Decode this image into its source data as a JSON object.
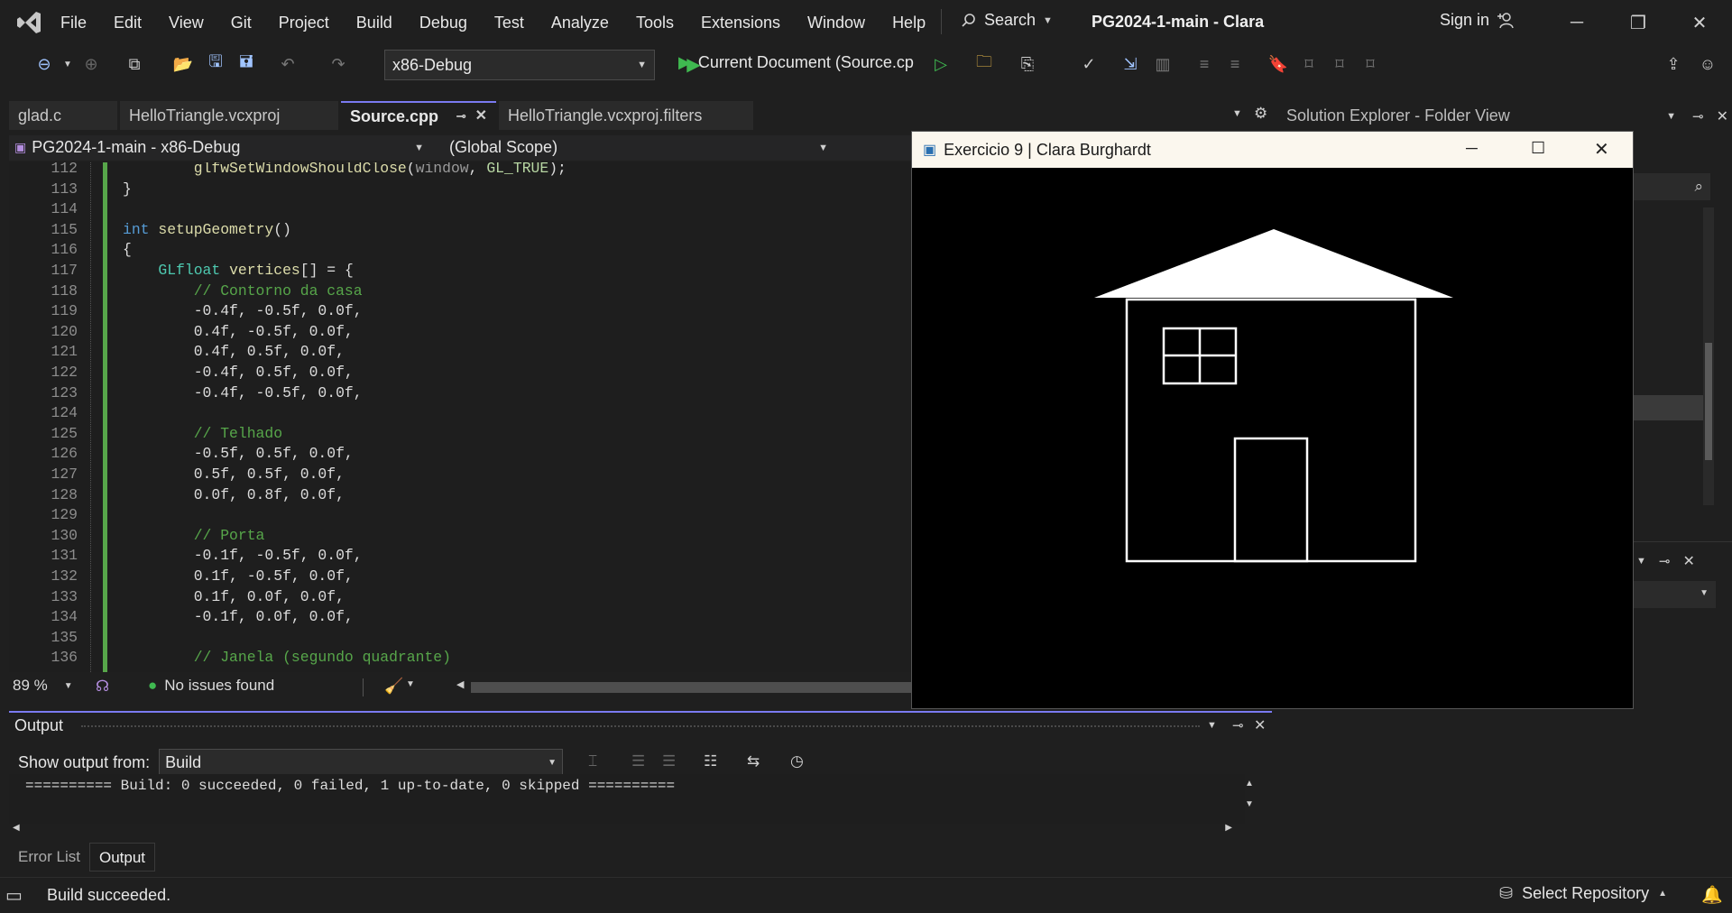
{
  "menu": {
    "items": [
      "File",
      "Edit",
      "View",
      "Git",
      "Project",
      "Build",
      "Debug",
      "Test",
      "Analyze",
      "Tools",
      "Extensions",
      "Window",
      "Help"
    ],
    "search_label": "Search",
    "solution_name": "PG2024-1-main - Clara",
    "sign_in": "Sign in"
  },
  "toolbar": {
    "configuration": "x86-Debug",
    "run_target": "Current Document (Source.cp"
  },
  "tabs": [
    {
      "label": "glad.c",
      "active": false
    },
    {
      "label": "HelloTriangle.vcxproj",
      "active": false
    },
    {
      "label": "Source.cpp",
      "active": true
    },
    {
      "label": "HelloTriangle.vcxproj.filters",
      "active": false
    }
  ],
  "editor": {
    "project_scope": "PG2024-1-main - x86-Debug",
    "member_scope": "(Global Scope)",
    "zoom": "89 %",
    "issues": "No issues found",
    "lines": [
      {
        "n": "112",
        "indent": "        ",
        "parts": [
          [
            "fn",
            "glfwSetWindowShouldClose"
          ],
          [
            "",
            "("
          ],
          [
            "pa",
            "window"
          ],
          [
            "",
            ", "
          ],
          [
            "cst",
            "GL_TRUE"
          ],
          [
            "",
            ");"
          ]
        ]
      },
      {
        "n": "113",
        "indent": "",
        "parts": [
          [
            "",
            "}"
          ]
        ]
      },
      {
        "n": "114",
        "indent": "",
        "parts": []
      },
      {
        "n": "115",
        "indent": "",
        "parts": [
          [
            "kw",
            "int"
          ],
          [
            "",
            " "
          ],
          [
            "fn",
            "setupGeometry"
          ],
          [
            "",
            "()"
          ]
        ]
      },
      {
        "n": "116",
        "indent": "",
        "parts": [
          [
            "",
            "{"
          ]
        ]
      },
      {
        "n": "117",
        "indent": "    ",
        "parts": [
          [
            "ty",
            "GLfloat"
          ],
          [
            "",
            " "
          ],
          [
            "fn",
            "vertices"
          ],
          [
            "",
            "[] = {"
          ]
        ]
      },
      {
        "n": "118",
        "indent": "        ",
        "parts": [
          [
            "cm",
            "// Contorno da casa"
          ]
        ]
      },
      {
        "n": "119",
        "indent": "        ",
        "parts": [
          [
            "",
            "-0.4f, -0.5f, 0.0f,"
          ]
        ]
      },
      {
        "n": "120",
        "indent": "        ",
        "parts": [
          [
            "",
            "0.4f, -0.5f, 0.0f,"
          ]
        ]
      },
      {
        "n": "121",
        "indent": "        ",
        "parts": [
          [
            "",
            "0.4f, 0.5f, 0.0f,"
          ]
        ]
      },
      {
        "n": "122",
        "indent": "        ",
        "parts": [
          [
            "",
            "-0.4f, 0.5f, 0.0f,"
          ]
        ]
      },
      {
        "n": "123",
        "indent": "        ",
        "parts": [
          [
            "",
            "-0.4f, -0.5f, 0.0f,"
          ]
        ]
      },
      {
        "n": "124",
        "indent": "",
        "parts": []
      },
      {
        "n": "125",
        "indent": "        ",
        "parts": [
          [
            "cm",
            "// Telhado"
          ]
        ]
      },
      {
        "n": "126",
        "indent": "        ",
        "parts": [
          [
            "",
            "-0.5f, 0.5f, 0.0f,"
          ]
        ]
      },
      {
        "n": "127",
        "indent": "        ",
        "parts": [
          [
            "",
            "0.5f, 0.5f, 0.0f,"
          ]
        ]
      },
      {
        "n": "128",
        "indent": "        ",
        "parts": [
          [
            "",
            "0.0f, 0.8f, 0.0f,"
          ]
        ]
      },
      {
        "n": "129",
        "indent": "",
        "parts": []
      },
      {
        "n": "130",
        "indent": "        ",
        "parts": [
          [
            "cm",
            "// Porta"
          ]
        ]
      },
      {
        "n": "131",
        "indent": "        ",
        "parts": [
          [
            "",
            "-0.1f, -0.5f, 0.0f,"
          ]
        ]
      },
      {
        "n": "132",
        "indent": "        ",
        "parts": [
          [
            "",
            "0.1f, -0.5f, 0.0f,"
          ]
        ]
      },
      {
        "n": "133",
        "indent": "        ",
        "parts": [
          [
            "",
            "0.1f, 0.0f, 0.0f,"
          ]
        ]
      },
      {
        "n": "134",
        "indent": "        ",
        "parts": [
          [
            "",
            "-0.1f, 0.0f, 0.0f,"
          ]
        ]
      },
      {
        "n": "135",
        "indent": "",
        "parts": []
      },
      {
        "n": "136",
        "indent": "        ",
        "parts": [
          [
            "cm",
            "// Janela (segundo quadrante)"
          ]
        ]
      }
    ]
  },
  "solution_explorer": {
    "title": "Solution Explorer - Folder View"
  },
  "gl_window": {
    "title": "Exercicio 9 | Clara Burghardt"
  },
  "output": {
    "title": "Output",
    "show_from_label": "Show output from:",
    "source": "Build",
    "text": "========== Build: 0 succeeded, 0 failed, 1 up-to-date, 0 skipped ==========",
    "tabs": [
      "Error List",
      "Output"
    ]
  },
  "status": {
    "message": "Build succeeded.",
    "repository": "Select Repository"
  },
  "colors": {
    "accent": "#7a7af0",
    "green_bar": "#57a64a",
    "run_green": "#3fb950"
  }
}
